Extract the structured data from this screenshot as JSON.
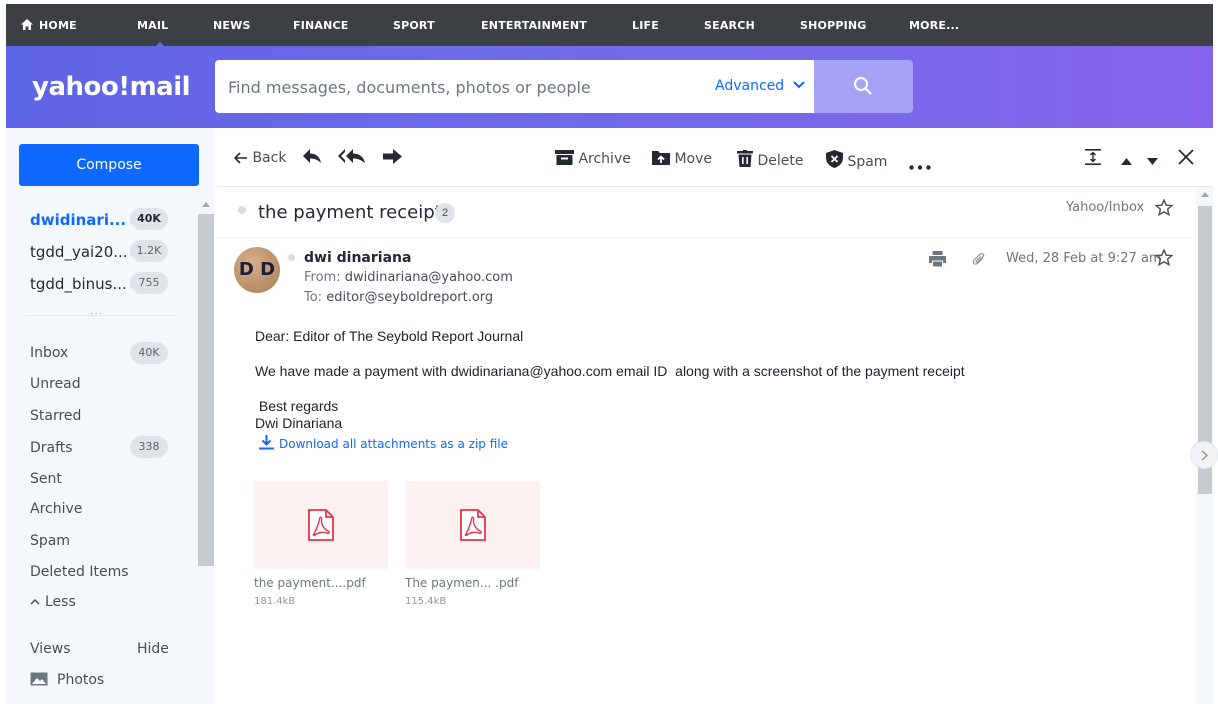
{
  "topnav": {
    "items": [
      "HOME",
      "MAIL",
      "NEWS",
      "FINANCE",
      "SPORT",
      "ENTERTAINMENT",
      "LIFE",
      "SEARCH",
      "SHOPPING",
      "MORE..."
    ],
    "active": "MAIL"
  },
  "header": {
    "logo": "yahoo!mail",
    "search_placeholder": "Find messages, documents, photos or people",
    "advanced_label": "Advanced"
  },
  "sidebar": {
    "compose_label": "Compose",
    "accounts": [
      {
        "name": "dwidinari...",
        "count": "40K"
      },
      {
        "name": "tgdd_yai20...",
        "count": "1.2K"
      },
      {
        "name": "tgdd_binus...",
        "count": "755"
      }
    ],
    "folders": [
      {
        "label": "Inbox",
        "count": "40K"
      },
      {
        "label": "Unread",
        "count": ""
      },
      {
        "label": "Starred",
        "count": ""
      },
      {
        "label": "Drafts",
        "count": "338"
      },
      {
        "label": "Sent",
        "count": ""
      },
      {
        "label": "Archive",
        "count": ""
      },
      {
        "label": "Spam",
        "count": ""
      },
      {
        "label": "Deleted Items",
        "count": ""
      }
    ],
    "less_label": "Less",
    "views_label": "Views",
    "hide_label": "Hide",
    "photos_label": "Photos"
  },
  "toolbar": {
    "back_label": "Back",
    "archive_label": "Archive",
    "move_label": "Move",
    "delete_label": "Delete",
    "spam_label": "Spam"
  },
  "message": {
    "subject": "the payment receipt",
    "thread_count": "2",
    "folder_path": "Yahoo/Inbox",
    "sender_initials": "D D",
    "sender_name": "dwi dinariana",
    "from_label": "From:",
    "from_email": "dwidinariana@yahoo.com",
    "to_label": "To:",
    "to_email": "editor@seyboldreport.org",
    "date": "Wed, 28 Feb at 9:27 am",
    "body": [
      "Dear: Editor of The Seybold Report Journal",
      "We have made a payment with dwidinariana@yahoo.com email ID  along with a screenshot of the payment receipt",
      " Best regards",
      "Dwi Dinariana"
    ],
    "download_label": "Download all attachments as a zip file",
    "attachments": [
      {
        "name": "the payment....pdf",
        "size": "181.4kB"
      },
      {
        "name": "The paymen... .pdf",
        "size": "115.4kB"
      }
    ]
  },
  "colors": {
    "nav_bg": "#3c4045",
    "header_gradient_start": "#5e64e6",
    "header_gradient_end": "#8663ec",
    "accent_blue": "#0f69ff",
    "pdf_icon": "#e8334a"
  }
}
